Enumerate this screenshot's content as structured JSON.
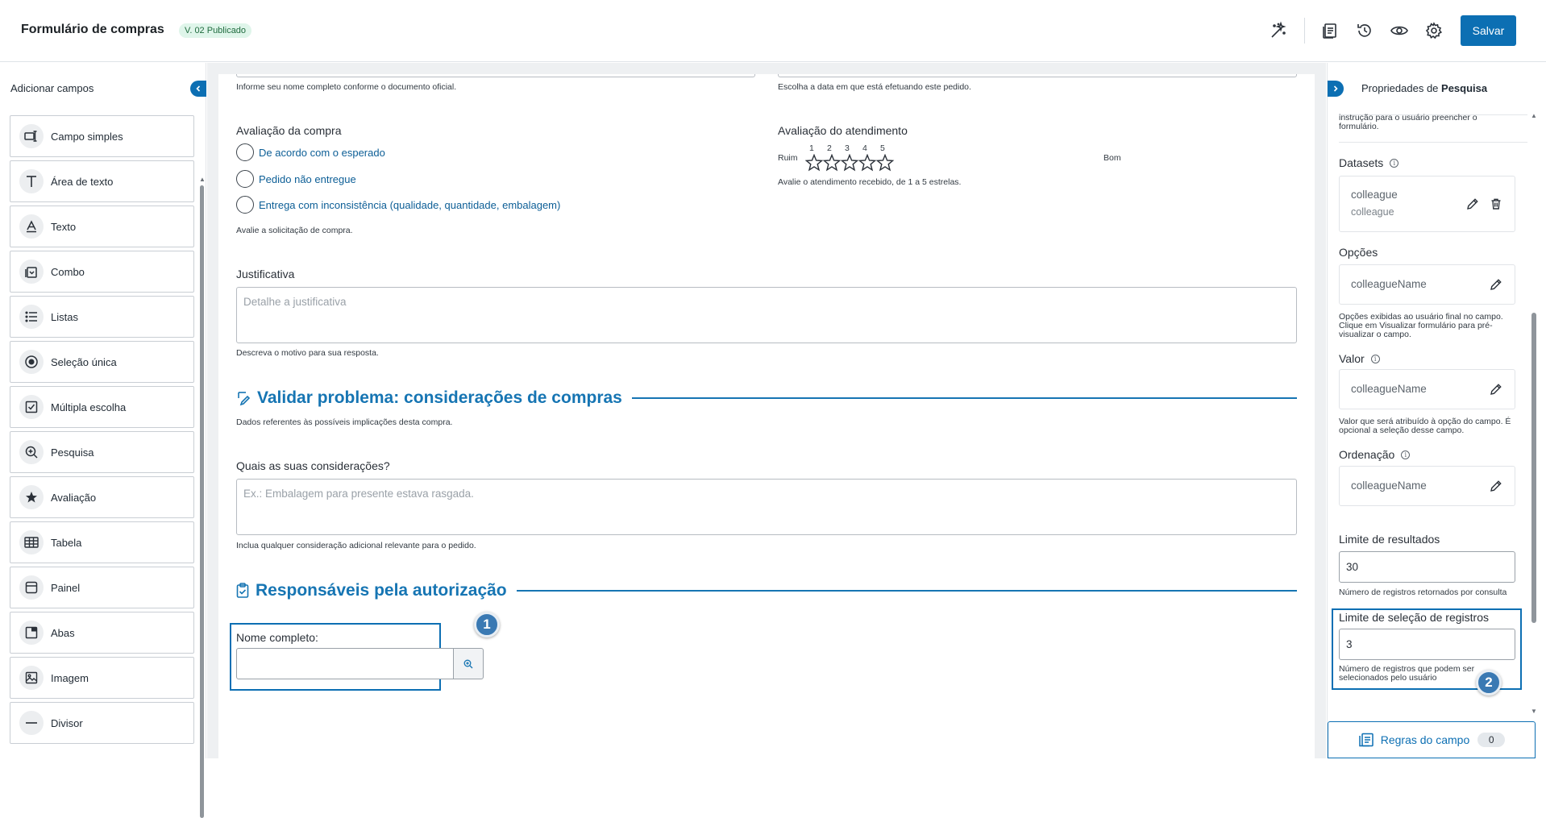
{
  "header": {
    "title": "Formulário de compras",
    "version_badge": "V. 02 Publicado",
    "save_label": "Salvar",
    "icons": [
      "magic-sparkle-icon",
      "document-list-icon",
      "history-icon",
      "eye-icon",
      "gear-icon"
    ]
  },
  "left_panel": {
    "title": "Adicionar campos",
    "items": [
      {
        "label": "Campo simples",
        "icon": "single-field-icon"
      },
      {
        "label": "Área de texto",
        "icon": "text-area-icon"
      },
      {
        "label": "Texto",
        "icon": "text-icon"
      },
      {
        "label": "Combo",
        "icon": "combo-icon"
      },
      {
        "label": "Listas",
        "icon": "list-icon"
      },
      {
        "label": "Seleção única",
        "icon": "radio-icon"
      },
      {
        "label": "Múltipla escolha",
        "icon": "checkbox-icon"
      },
      {
        "label": "Pesquisa",
        "icon": "search-zoom-icon"
      },
      {
        "label": "Avaliação",
        "icon": "star-icon"
      },
      {
        "label": "Tabela",
        "icon": "table-icon"
      },
      {
        "label": "Painel",
        "icon": "panel-icon"
      },
      {
        "label": "Abas",
        "icon": "tabs-icon"
      },
      {
        "label": "Imagem",
        "icon": "image-icon"
      },
      {
        "label": "Divisor",
        "icon": "divider-icon"
      }
    ]
  },
  "form": {
    "name_help": "Informe seu nome completo conforme o documento oficial.",
    "date_help": "Escolha a data em que está efetuando este pedido.",
    "purchase_rating": {
      "label": "Avaliação da compra",
      "options": [
        "De acordo com o esperado",
        "Pedido não entregue",
        "Entrega com inconsistência (qualidade, quantidade, embalagem)"
      ],
      "help": "Avalie a solicitação de compra."
    },
    "service_rating": {
      "label": "Avaliação do atendimento",
      "low": "Ruim",
      "high": "Bom",
      "scale": [
        "1",
        "2",
        "3",
        "4",
        "5"
      ],
      "help": "Avalie o atendimento recebido, de 1 a 5 estrelas."
    },
    "justification": {
      "label": "Justificativa",
      "placeholder": "Detalhe a justificativa",
      "help": "Descreva o motivo para sua resposta."
    },
    "section_validate": {
      "title": "Validar problema: considerações de compras",
      "subtitle": "Dados referentes às possíveis implicações desta compra."
    },
    "considerations": {
      "label": "Quais as suas considerações?",
      "placeholder": "Ex.: Embalagem para presente estava rasgada.",
      "help": "Inclua qualquer consideração adicional relevante para o pedido."
    },
    "section_responsibles": {
      "title": "Responsáveis pela autorização"
    },
    "full_name": {
      "label": "Nome completo:",
      "value": ""
    },
    "step_1": "1"
  },
  "right_panel": {
    "title_prefix": "Propriedades de",
    "title_bold": "Pesquisa",
    "instruction_tail": "instrução para o usuário preencher o formulário.",
    "datasets": {
      "label": "Datasets",
      "name": "colleague",
      "sub": "colleague"
    },
    "options": {
      "label": "Opções",
      "value": "colleagueName",
      "help": "Opções exibidas ao usuário final no campo. Clique em Visualizar formulário para pré-visualizar o campo."
    },
    "value": {
      "label": "Valor",
      "value": "colleagueName",
      "help": "Valor que será atribuído à opção do campo. É opcional a seleção desse campo."
    },
    "ordering": {
      "label": "Ordenação",
      "value": "colleagueName"
    },
    "result_limit": {
      "label": "Limite de resultados",
      "value": "30",
      "help": "Número de registros retornados por consulta"
    },
    "selection_limit": {
      "label": "Limite de seleção de registros",
      "value": "3",
      "help": "Número de registros que podem ser selecionados pelo usuário"
    },
    "step_2": "2",
    "rules": {
      "label": "Regras do campo",
      "count": "0"
    }
  }
}
